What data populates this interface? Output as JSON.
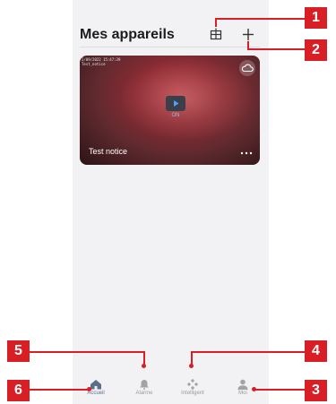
{
  "header": {
    "title": "Mes appareils"
  },
  "device_card": {
    "timestamp": "2/09/2022 15:47:39",
    "subtitle": "Test_notice",
    "name": "Test notice",
    "play_label": "ON"
  },
  "tabs": [
    {
      "label": "Accueil",
      "active": true,
      "icon": "home-icon"
    },
    {
      "label": "Alarme",
      "active": false,
      "icon": "bell-icon"
    },
    {
      "label": "Intelligent",
      "active": false,
      "icon": "smart-diamond-icon"
    },
    {
      "label": "Moi",
      "active": false,
      "icon": "person-icon"
    }
  ],
  "callouts": [
    "1",
    "2",
    "3",
    "4",
    "5",
    "6"
  ],
  "colors": {
    "accent": "#5d6e8c",
    "callout": "#d81f26",
    "background": "#f2f2f4"
  }
}
